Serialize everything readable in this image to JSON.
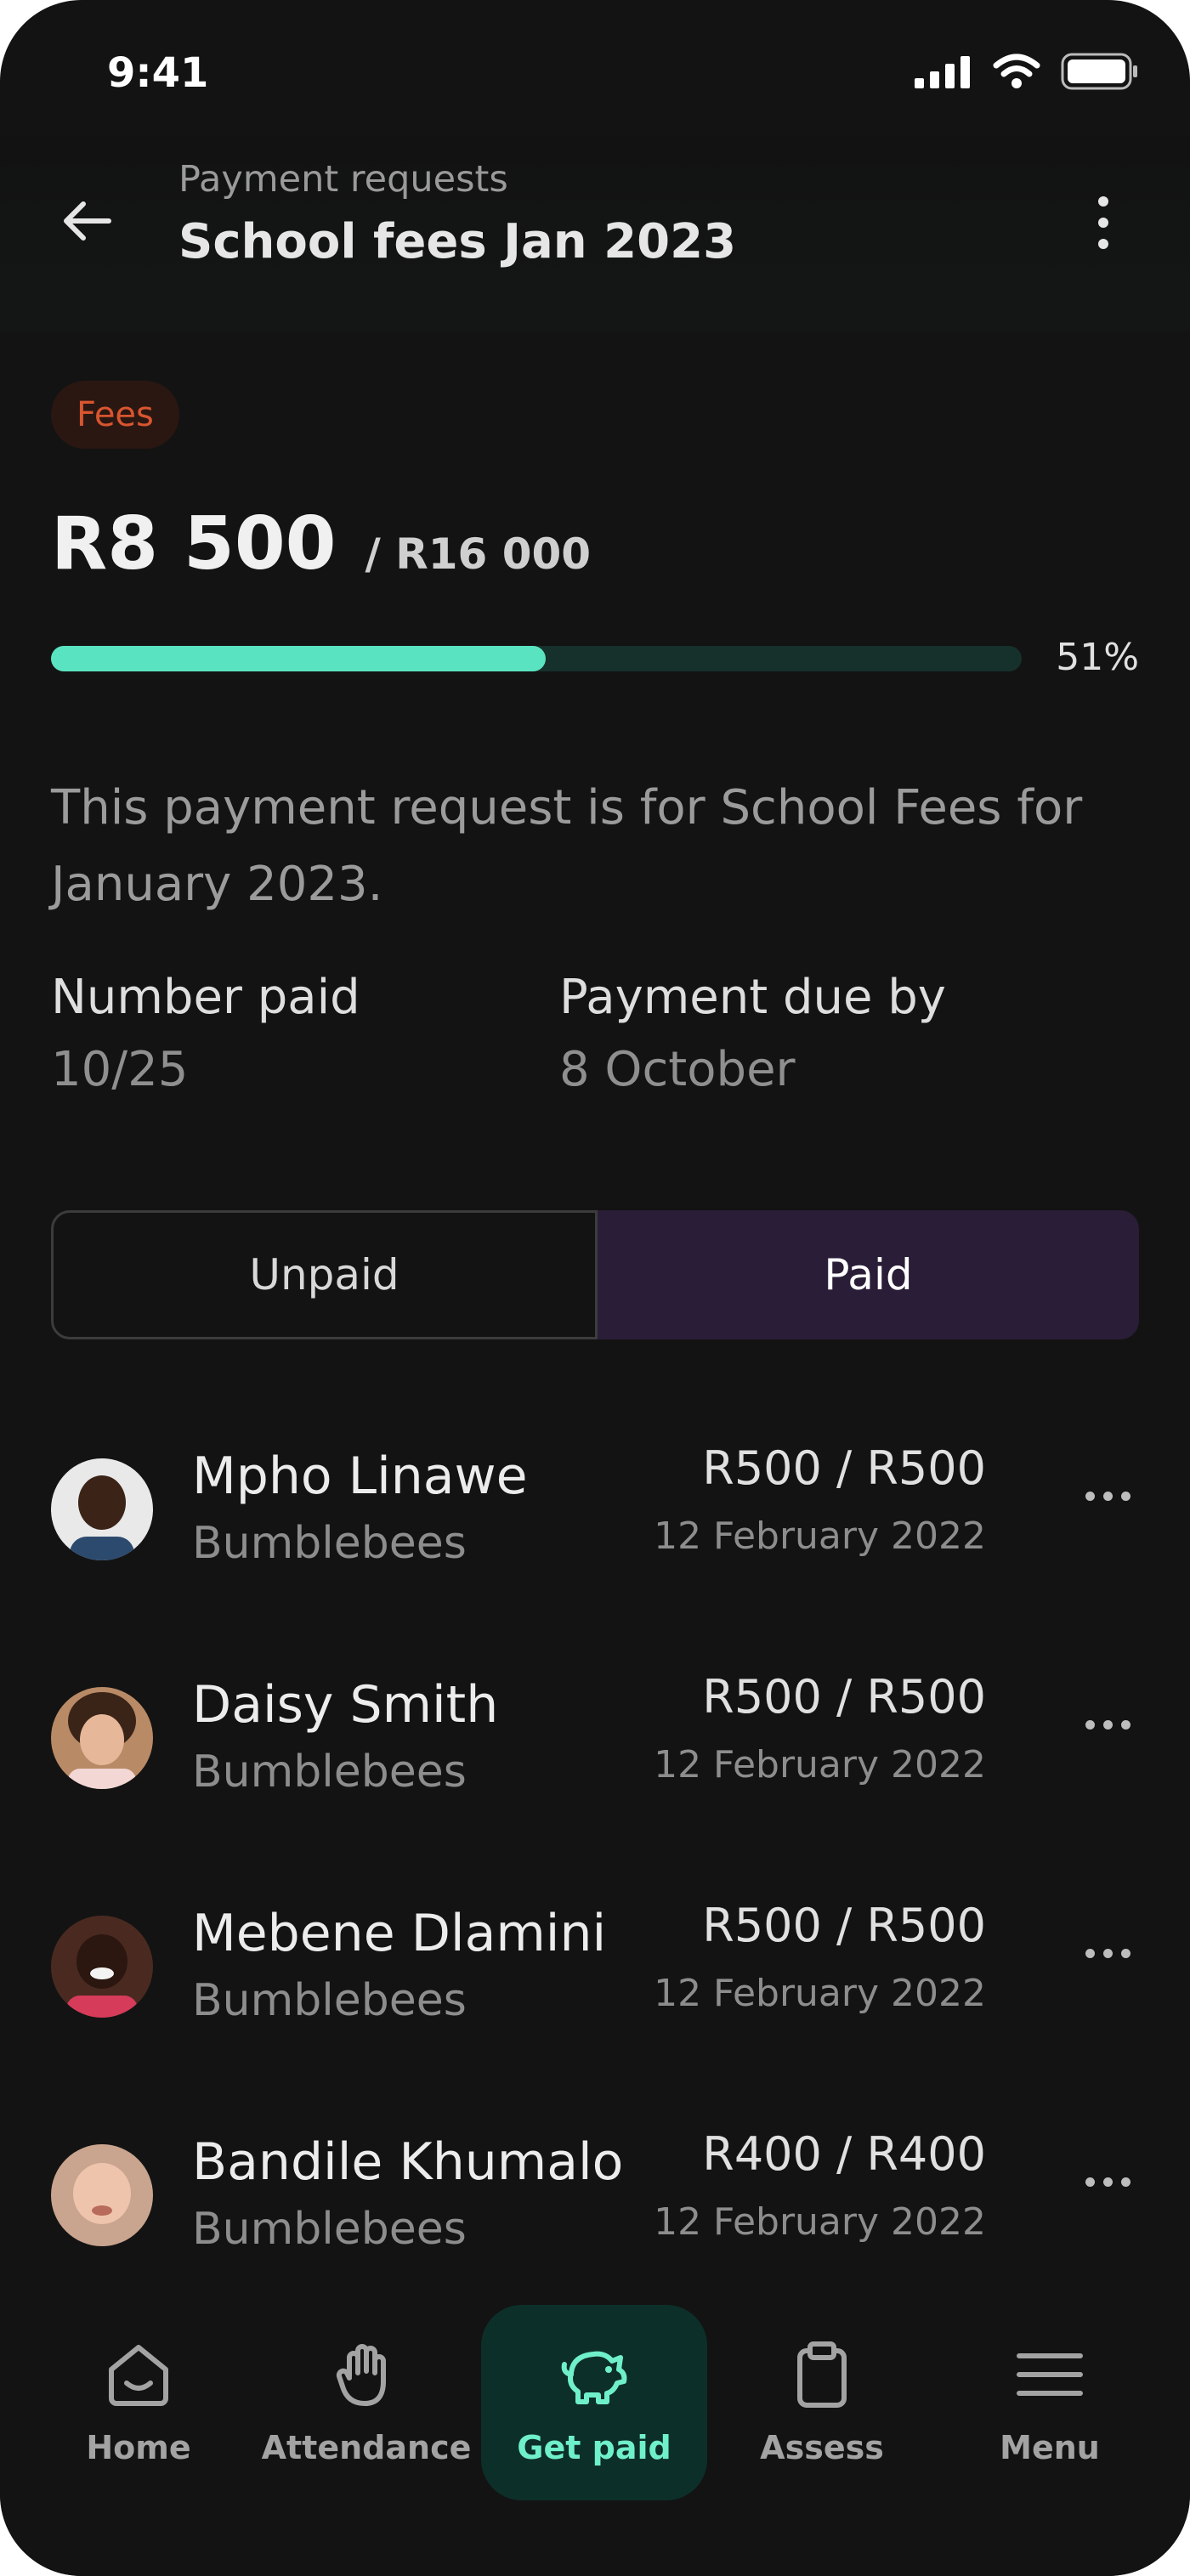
{
  "status_bar": {
    "time": "9:41"
  },
  "header": {
    "subtitle": "Payment requests",
    "title": "School fees Jan 2023"
  },
  "badge": {
    "label": "Fees",
    "color": "#d8552f"
  },
  "summary": {
    "amount": "R8 500",
    "total": "/ R16 000",
    "progress_percent": 51,
    "progress_label": "51%",
    "accent": "#5ae3c0"
  },
  "description": "This payment request is for School Fees for January 2023.",
  "stats": {
    "number_paid_label": "Number paid",
    "number_paid_value": "10/25",
    "due_label": "Payment due by",
    "due_value": "8 October"
  },
  "segment": {
    "unpaid": "Unpaid",
    "paid": "Paid",
    "selected": "paid"
  },
  "payments": [
    {
      "name": "Mpho Linawe",
      "group": "Bumblebees",
      "amount": "R500 / R500",
      "date": "12 February 2022"
    },
    {
      "name": "Daisy Smith",
      "group": "Bumblebees",
      "amount": "R500 / R500",
      "date": "12 February 2022"
    },
    {
      "name": "Mebene Dlamini",
      "group": "Bumblebees",
      "amount": "R500 / R500",
      "date": "12 February 2022"
    },
    {
      "name": "Bandile Khumalo",
      "group": "Bumblebees",
      "amount": "R400 / R400",
      "date": "12 February 2022"
    }
  ],
  "nav": {
    "items": [
      {
        "label": "Home",
        "icon": "home-icon"
      },
      {
        "label": "Attendance",
        "icon": "hand-icon"
      },
      {
        "label": "Get paid",
        "icon": "piggy-bank-icon",
        "active": true
      },
      {
        "label": "Assess",
        "icon": "clipboard-icon"
      },
      {
        "label": "Menu",
        "icon": "menu-icon"
      }
    ]
  }
}
